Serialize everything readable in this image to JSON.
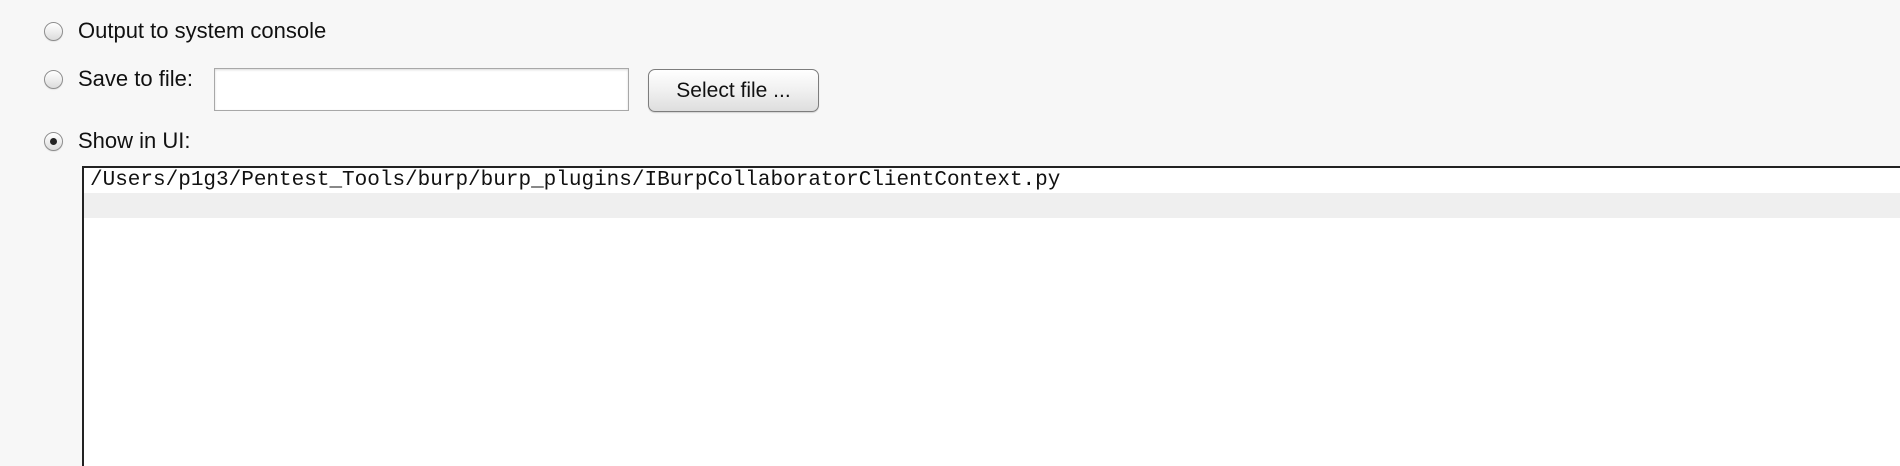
{
  "options": {
    "console_label": "Output to system console",
    "file_label": "Save to file:",
    "ui_label": "Show in UI:"
  },
  "file": {
    "value": "",
    "select_label": "Select file ..."
  },
  "output": {
    "lines": [
      "/Users/p1g3/Pentest_Tools/burp/burp_plugins/IBurpCollaboratorClientContext.py",
      ""
    ]
  },
  "selected_option": "ui"
}
